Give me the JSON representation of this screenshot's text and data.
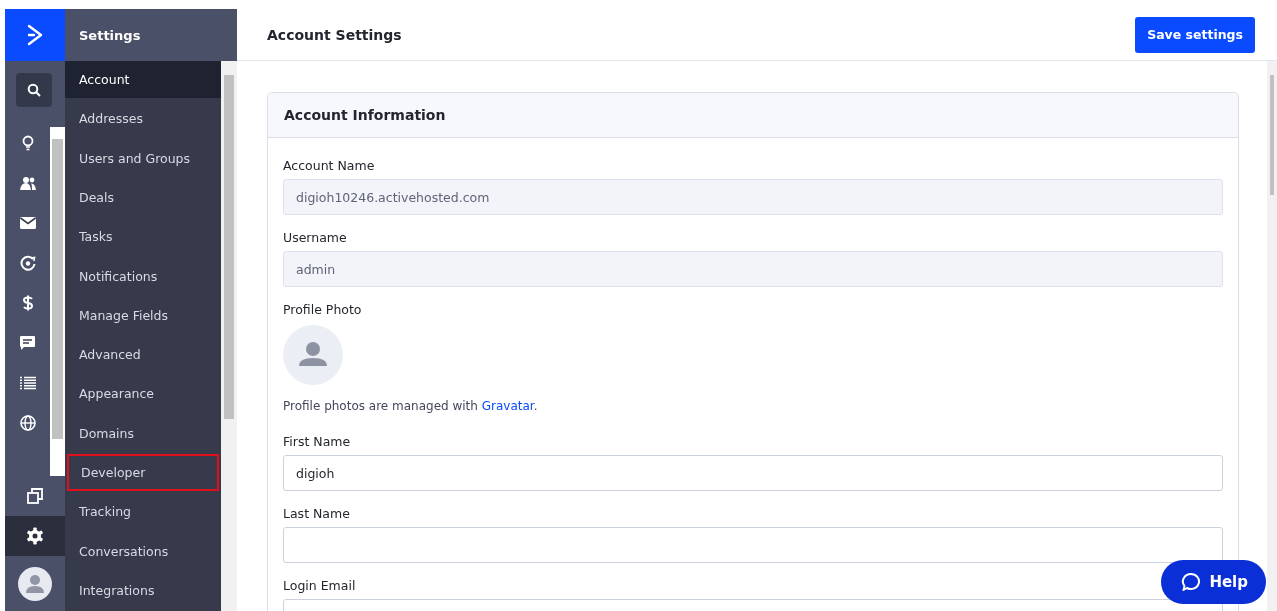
{
  "rail": {
    "items": [
      {
        "kind": "search"
      },
      {
        "kind": "bulb"
      },
      {
        "kind": "contacts"
      },
      {
        "kind": "mail"
      },
      {
        "kind": "automation"
      },
      {
        "kind": "dollar"
      },
      {
        "kind": "chat"
      },
      {
        "kind": "list"
      },
      {
        "kind": "globe"
      }
    ],
    "bottom": [
      {
        "kind": "copy",
        "selected": false
      },
      {
        "kind": "gear",
        "selected": true
      }
    ]
  },
  "settings_nav": {
    "title": "Settings",
    "items": [
      {
        "label": "Account",
        "selected": true,
        "highlighted": false
      },
      {
        "label": "Addresses",
        "selected": false,
        "highlighted": false
      },
      {
        "label": "Users and Groups",
        "selected": false,
        "highlighted": false
      },
      {
        "label": "Deals",
        "selected": false,
        "highlighted": false
      },
      {
        "label": "Tasks",
        "selected": false,
        "highlighted": false
      },
      {
        "label": "Notifications",
        "selected": false,
        "highlighted": false
      },
      {
        "label": "Manage Fields",
        "selected": false,
        "highlighted": false
      },
      {
        "label": "Advanced",
        "selected": false,
        "highlighted": false
      },
      {
        "label": "Appearance",
        "selected": false,
        "highlighted": false
      },
      {
        "label": "Domains",
        "selected": false,
        "highlighted": false
      },
      {
        "label": "Developer",
        "selected": false,
        "highlighted": true
      },
      {
        "label": "Tracking",
        "selected": false,
        "highlighted": false
      },
      {
        "label": "Conversations",
        "selected": false,
        "highlighted": false
      },
      {
        "label": "Integrations",
        "selected": false,
        "highlighted": false
      }
    ]
  },
  "header": {
    "title": "Account Settings",
    "save_button": "Save settings"
  },
  "card": {
    "title": "Account Information",
    "fields": [
      {
        "kind": "input",
        "label": "Account Name",
        "value": "digioh10246.activehosted.com",
        "disabled": true
      },
      {
        "kind": "input",
        "label": "Username",
        "value": "admin",
        "disabled": true
      },
      {
        "kind": "photo",
        "label": "Profile Photo",
        "note": "Profile photos are managed with ",
        "link": "Gravatar",
        "note_end": "."
      },
      {
        "kind": "input",
        "label": "First Name",
        "value": "digioh",
        "disabled": false
      },
      {
        "kind": "input",
        "label": "Last Name",
        "disabled": false
      },
      {
        "kind": "input",
        "label": "Login Email",
        "disabled": false
      }
    ]
  },
  "help_button": "Help"
}
